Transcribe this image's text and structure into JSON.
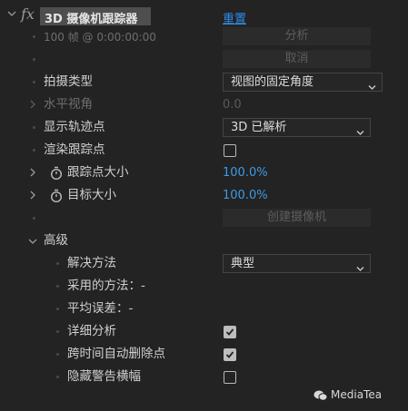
{
  "header": {
    "fx_label": "fx",
    "effect_title": "3D 摄像机跟踪器",
    "reset_link": "重置"
  },
  "rows": {
    "frame_info": "100 帧 @ 0:00:00:00",
    "analyze_button": "分析",
    "cancel_button": "取消",
    "shot_type_label": "拍摄类型",
    "shot_type_value": "视图的固定角度",
    "hfov_label": "水平视角",
    "hfov_value": "0.0",
    "show_track_points_label": "显示轨迹点",
    "show_track_points_value": "3D 已解析",
    "render_track_points_label": "渲染跟踪点",
    "track_point_size_label": "跟踪点大小",
    "track_point_size_value": "100.0",
    "track_point_size_unit": "%",
    "target_size_label": "目标大小",
    "target_size_value": "100.0",
    "target_size_unit": "%",
    "create_camera_button": "创建摄像机"
  },
  "advanced": {
    "section_label": "高级",
    "solve_method_label": "解决方法",
    "solve_method_value": "典型",
    "method_used_label": "采用的方法：-",
    "avg_error_label": "平均误差：-",
    "detailed_analysis_label": "详细分析",
    "auto_delete_label": "跨时间自动删除点",
    "hide_warning_label": "隐藏警告横幅"
  },
  "checkboxes": {
    "render_track_points": false,
    "detailed_analysis": true,
    "auto_delete": true,
    "hide_warning": false
  },
  "watermark": {
    "text": "MediaTea"
  },
  "colors": {
    "background": "#232323",
    "header_bar": "#4e4e4e",
    "link": "#2d8ceb",
    "value": "#3c9be6"
  }
}
